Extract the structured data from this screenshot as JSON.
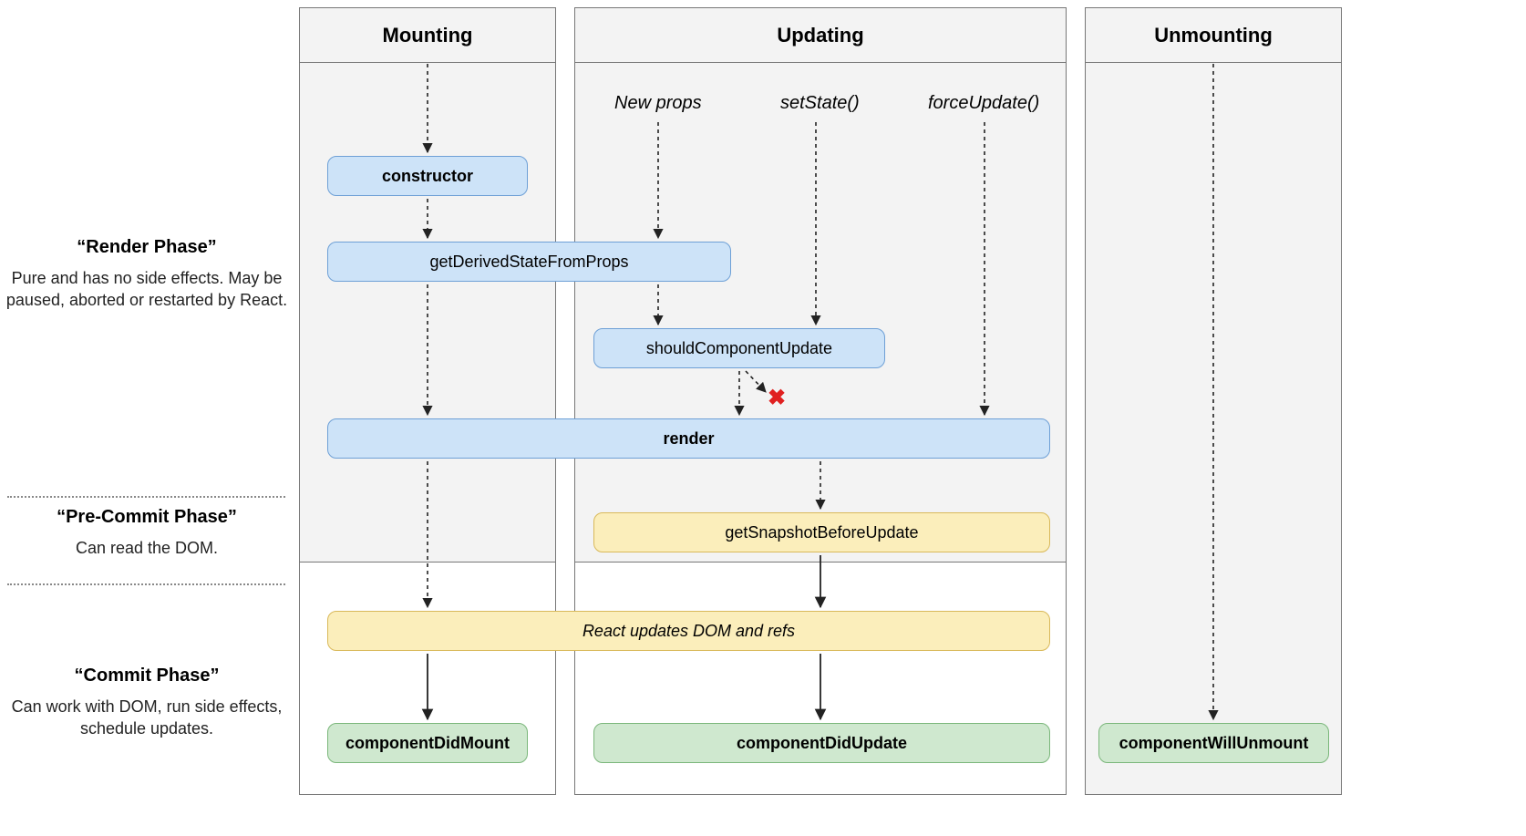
{
  "phases": {
    "render": {
      "title": "“Render Phase”",
      "desc": "Pure and has no side effects. May be paused, aborted or restarted by React."
    },
    "precommit": {
      "title": "“Pre-Commit Phase”",
      "desc": "Can read the DOM."
    },
    "commit": {
      "title": "“Commit Phase”",
      "desc": "Can work with DOM, run side effects, schedule updates."
    }
  },
  "columns": {
    "mounting": "Mounting",
    "updating": "Updating",
    "unmounting": "Unmounting"
  },
  "triggers": {
    "newprops": "New props",
    "setstate": "setState()",
    "forceupdate": "forceUpdate()"
  },
  "nodes": {
    "constructor": "constructor",
    "gdsfp": "getDerivedStateFromProps",
    "scu": "shouldComponentUpdate",
    "render": "render",
    "gsbu": "getSnapshotBeforeUpdate",
    "reactupdates": "React updates DOM and refs",
    "cdm": "componentDidMount",
    "cdu": "componentDidUpdate",
    "cwu": "componentWillUnmount"
  },
  "halt": "✖"
}
